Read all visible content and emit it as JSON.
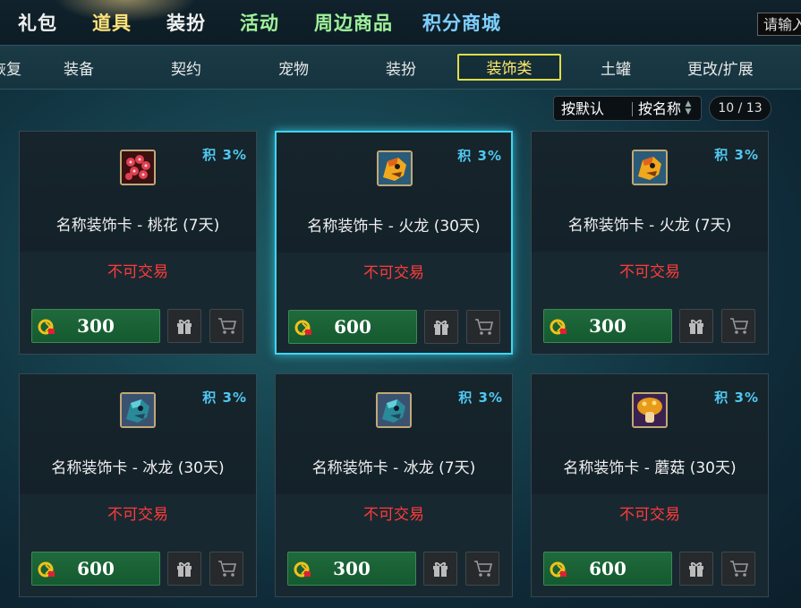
{
  "top_nav": {
    "tabs": [
      "礼包",
      "道具",
      "装扮",
      "活动",
      "周边商品",
      "积分商城"
    ],
    "search_placeholder": "请输入"
  },
  "sub_nav": {
    "tabs": [
      "恢复",
      "装备",
      "契约",
      "宠物",
      "装扮",
      "装饰类",
      "土罐",
      "更改/扩展"
    ],
    "active": "装饰类"
  },
  "sort": {
    "default_label": "按默认",
    "name_label": "按名称"
  },
  "pager": {
    "text": "10 / 13"
  },
  "cards": [
    {
      "bonus": "积 3%",
      "name": "名称装饰卡 - 桃花 (7天)",
      "trade": "不可交易",
      "price": "300",
      "icon": "peach-blossom-icon"
    },
    {
      "bonus": "积 3%",
      "name": "名称装饰卡 - 火龙 (30天)",
      "trade": "不可交易",
      "price": "600",
      "icon": "fire-dragon-icon"
    },
    {
      "bonus": "积 3%",
      "name": "名称装饰卡 - 火龙 (7天)",
      "trade": "不可交易",
      "price": "300",
      "icon": "fire-dragon-icon"
    },
    {
      "bonus": "积 3%",
      "name": "名称装饰卡 - 冰龙 (30天)",
      "trade": "不可交易",
      "price": "600",
      "icon": "ice-dragon-icon"
    },
    {
      "bonus": "积 3%",
      "name": "名称装饰卡 - 冰龙 (7天)",
      "trade": "不可交易",
      "price": "300",
      "icon": "ice-dragon-icon"
    },
    {
      "bonus": "积 3%",
      "name": "名称装饰卡 - 蘑菇 (30天)",
      "trade": "不可交易",
      "price": "600",
      "icon": "mushroom-icon"
    }
  ],
  "colors": {
    "active_tab_border": "#e3dc4a",
    "selected_card_border": "#3fd6f0",
    "trade_text": "#ff3b3b",
    "bonus_text": "#4fc8f0",
    "price_button": "#1f6a3c"
  }
}
